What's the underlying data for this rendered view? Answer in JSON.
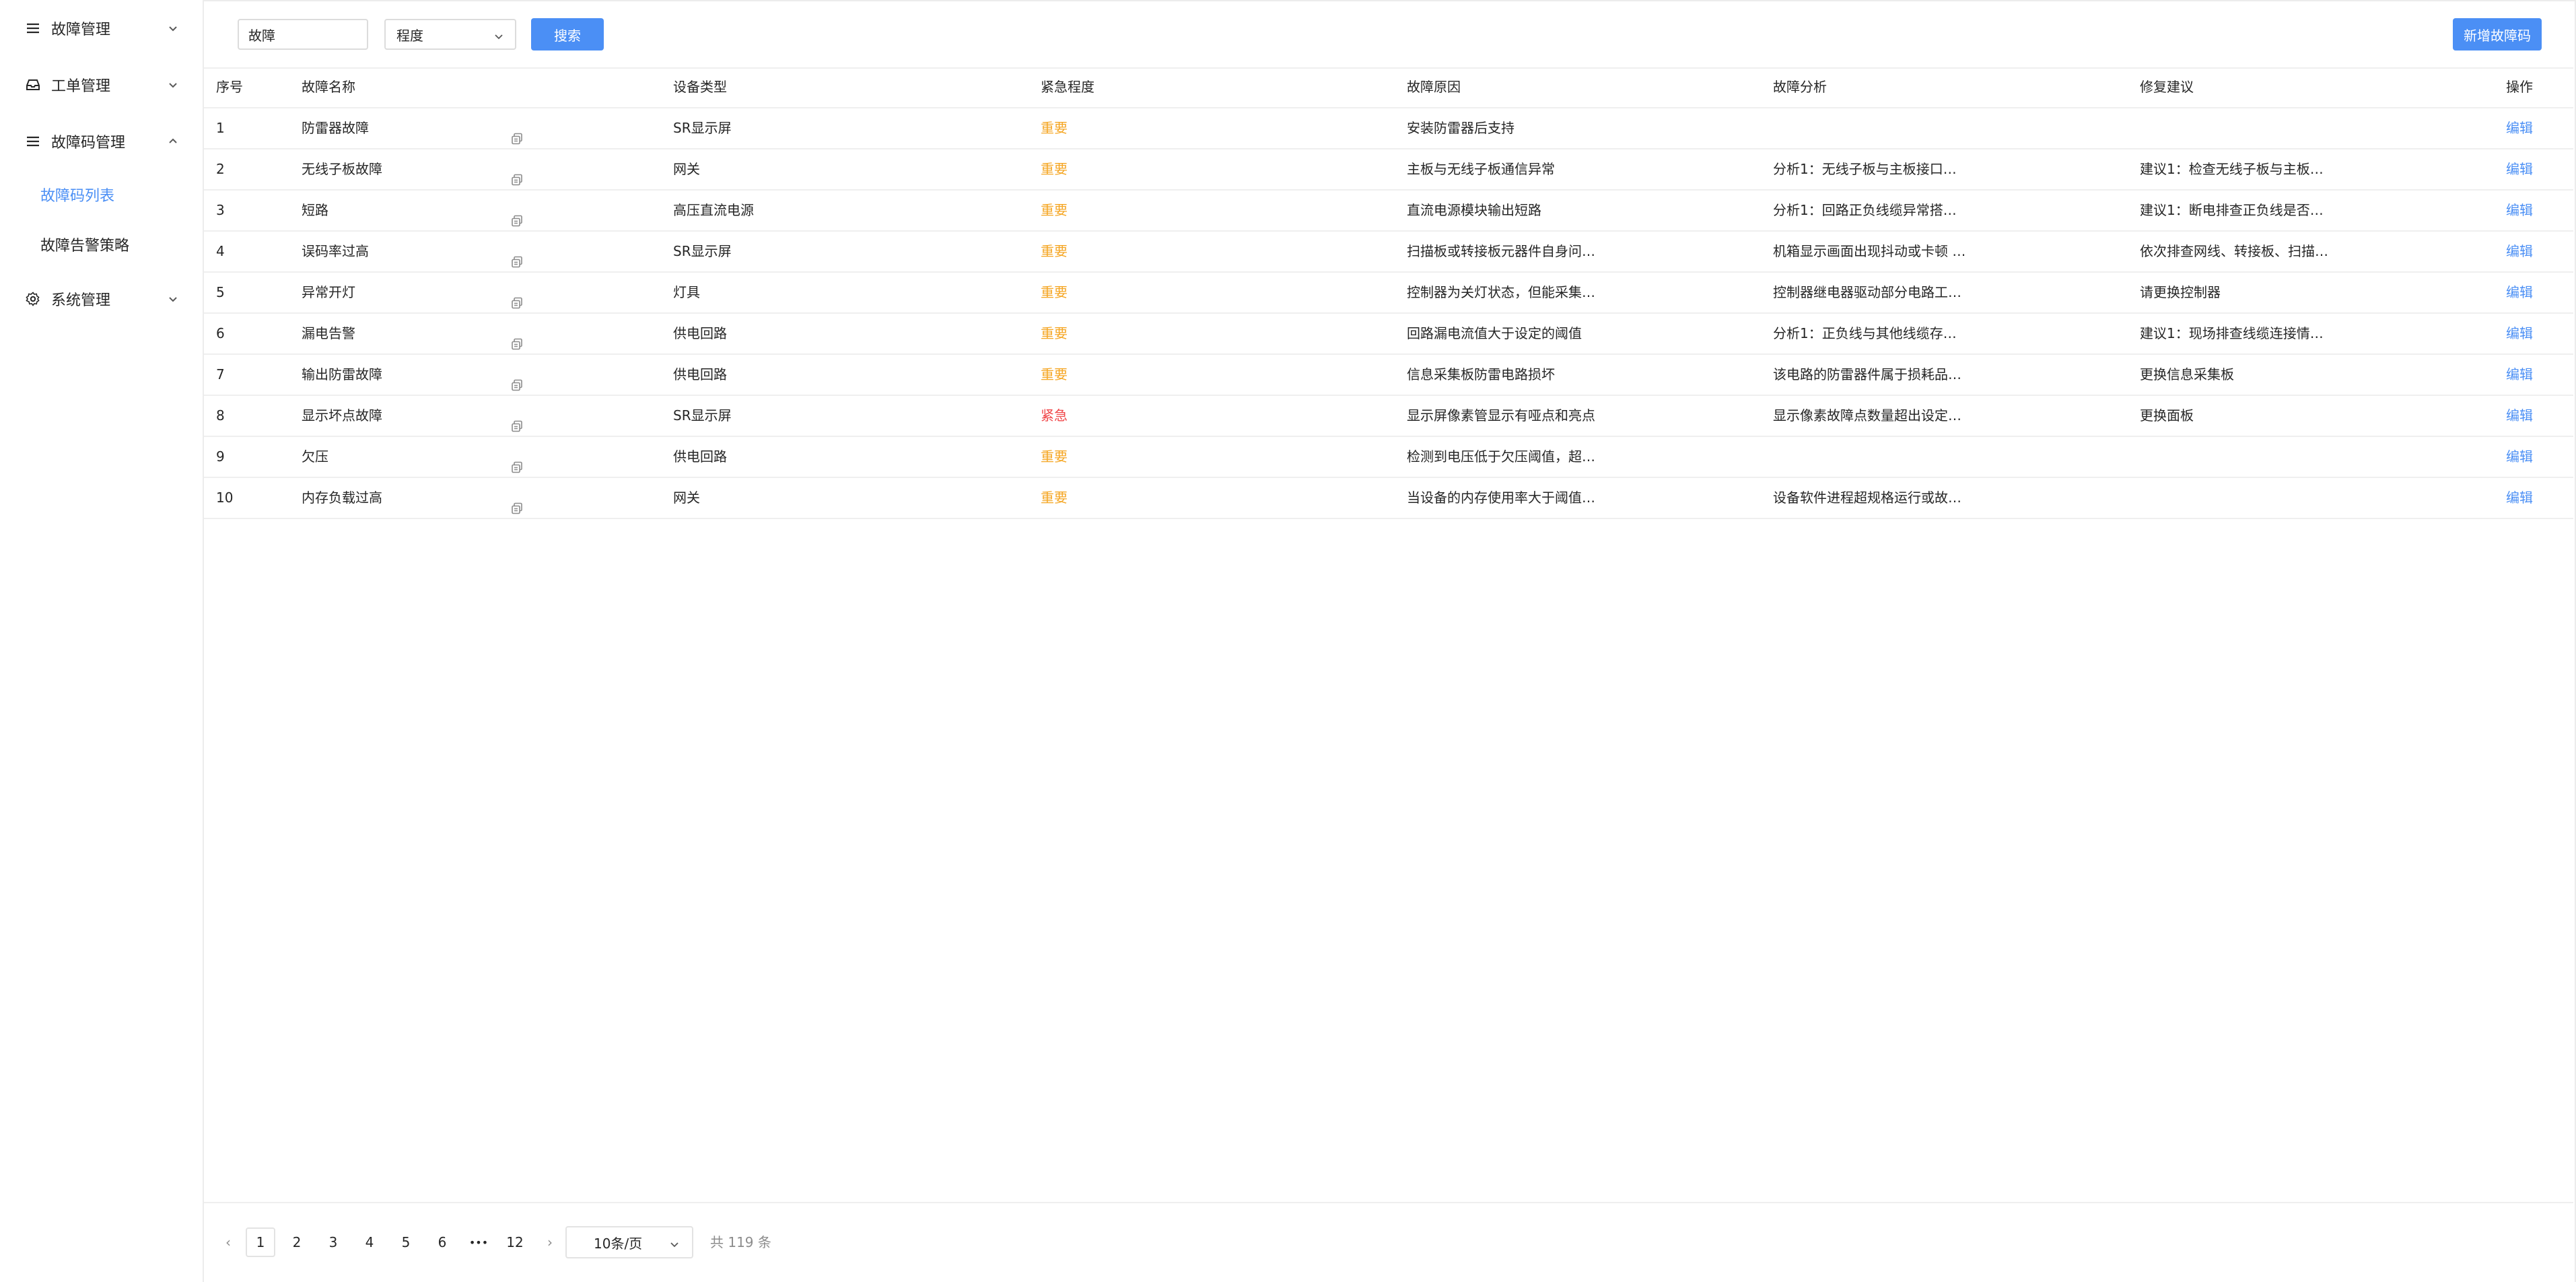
{
  "sidebar": {
    "items": [
      {
        "label": "故障管理",
        "icon": "list-icon",
        "expanded": false
      },
      {
        "label": "工单管理",
        "icon": "inbox-icon",
        "expanded": false
      },
      {
        "label": "故障码管理",
        "icon": "list-icon",
        "expanded": true
      },
      {
        "label": "系统管理",
        "icon": "gear-icon",
        "expanded": false
      }
    ],
    "sub_items": [
      {
        "label": "故障码列表",
        "active": true
      },
      {
        "label": "故障告警策略",
        "active": false
      }
    ]
  },
  "toolbar": {
    "search_value": "故障",
    "select_value": "程度",
    "search_label": "搜索",
    "add_label": "新增故障码"
  },
  "table": {
    "headers": {
      "index": "序号",
      "name": "故障名称",
      "device": "设备类型",
      "urgency": "紧急程度",
      "cause": "故障原因",
      "analysis": "故障分析",
      "suggestion": "修复建议",
      "op": "操作"
    },
    "edit_label": "编辑",
    "rows": [
      {
        "index": "1",
        "name": "防雷器故障",
        "device": "SR显示屏",
        "urgency": "重要",
        "cause": "安装防雷器后支持",
        "analysis": "",
        "suggestion": ""
      },
      {
        "index": "2",
        "name": "无线子板故障",
        "device": "网关",
        "urgency": "重要",
        "cause": "主板与无线子板通信异常",
        "analysis": "分析1：无线子板与主板接口…",
        "suggestion": "建议1：检查无线子板与主板…"
      },
      {
        "index": "3",
        "name": "短路",
        "device": "高压直流电源",
        "urgency": "重要",
        "cause": "直流电源模块输出短路",
        "analysis": "分析1：回路正负线缆异常搭…",
        "suggestion": "建议1：断电排查正负线是否…"
      },
      {
        "index": "4",
        "name": "误码率过高",
        "device": "SR显示屏",
        "urgency": "重要",
        "cause": "扫描板或转接板元器件自身问…",
        "analysis": "机箱显示画面出现抖动或卡顿 …",
        "suggestion": "依次排查网线、转接板、扫描…"
      },
      {
        "index": "5",
        "name": "异常开灯",
        "device": "灯具",
        "urgency": "重要",
        "cause": "控制器为关灯状态，但能采集…",
        "analysis": "控制器继电器驱动部分电路工…",
        "suggestion": "请更换控制器"
      },
      {
        "index": "6",
        "name": "漏电告警",
        "device": "供电回路",
        "urgency": "重要",
        "cause": "回路漏电流值大于设定的阈值",
        "analysis": "分析1：正负线与其他线缆存…",
        "suggestion": "建议1：现场排查线缆连接情…"
      },
      {
        "index": "7",
        "name": "输出防雷故障",
        "device": "供电回路",
        "urgency": "重要",
        "cause": "信息采集板防雷电路损坏",
        "analysis": "该电路的防雷器件属于损耗品…",
        "suggestion": "更换信息采集板"
      },
      {
        "index": "8",
        "name": "显示坏点故障",
        "device": "SR显示屏",
        "urgency": "紧急",
        "cause": "显示屏像素管显示有哑点和亮点",
        "analysis": "显示像素故障点数量超出设定…",
        "suggestion": "更换面板"
      },
      {
        "index": "9",
        "name": "欠压",
        "device": "供电回路",
        "urgency": "重要",
        "cause": "检测到电压低于欠压阈值，超…",
        "analysis": "",
        "suggestion": ""
      },
      {
        "index": "10",
        "name": "内存负载过高",
        "device": "网关",
        "urgency": "重要",
        "cause": "当设备的内存使用率大于阈值…",
        "analysis": "设备软件进程超规格运行或故…",
        "suggestion": ""
      }
    ]
  },
  "pagination": {
    "prev": "‹",
    "next": "›",
    "pages": [
      "1",
      "2",
      "3",
      "4",
      "5",
      "6"
    ],
    "ellipsis": "•••",
    "last": "12",
    "current": "1",
    "page_size": "10条/页",
    "total": "共 119 条"
  },
  "colors": {
    "accent": "#4b8ff5",
    "important": "#f5a623",
    "urgent": "#f0474a"
  }
}
